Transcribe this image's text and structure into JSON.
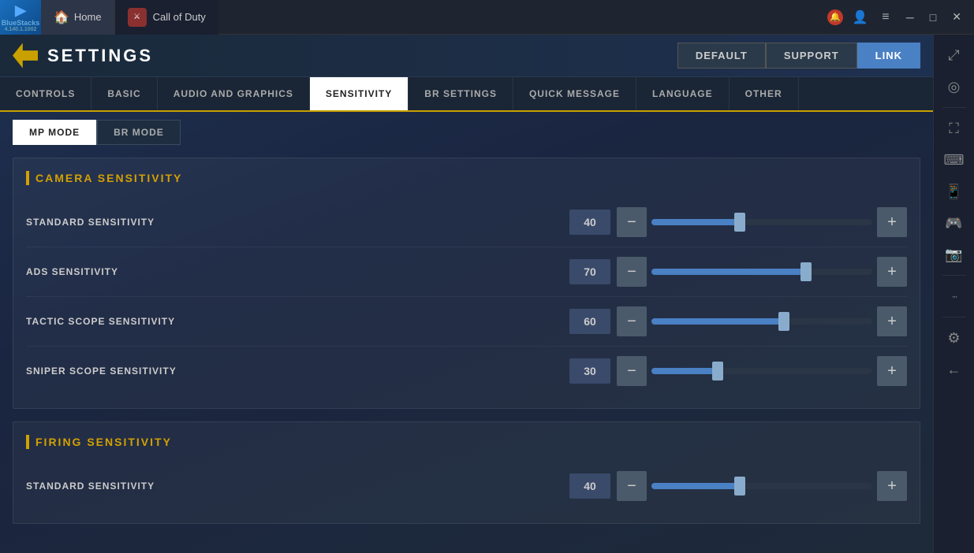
{
  "taskbar": {
    "app_name": "BlueStacks",
    "app_version": "4.140.1.1002",
    "tab_home": "Home",
    "tab_game": "Call of Duty",
    "window_controls": {
      "minimize": "─",
      "maximize": "□",
      "close": "✕"
    }
  },
  "settings": {
    "title": "SETTINGS",
    "header_buttons": [
      {
        "label": "DEFAULT",
        "active": false
      },
      {
        "label": "SUPPORT",
        "active": false
      },
      {
        "label": "LINK",
        "active": true
      }
    ],
    "nav_tabs": [
      {
        "label": "CONTROLS",
        "active": false
      },
      {
        "label": "BASIC",
        "active": false
      },
      {
        "label": "AUDIO AND GRAPHICS",
        "active": false
      },
      {
        "label": "SENSITIVITY",
        "active": true
      },
      {
        "label": "BR SETTINGS",
        "active": false
      },
      {
        "label": "QUICK MESSAGE",
        "active": false
      },
      {
        "label": "LANGUAGE",
        "active": false
      },
      {
        "label": "OTHER",
        "active": false
      }
    ],
    "mode_tabs": [
      {
        "label": "MP MODE",
        "active": true
      },
      {
        "label": "BR MODE",
        "active": false
      }
    ],
    "camera_section": {
      "title": "CAMERA SENSITIVITY",
      "rows": [
        {
          "label": "STANDARD SENSITIVITY",
          "value": "40",
          "pct": 40
        },
        {
          "label": "ADS SENSITIVITY",
          "value": "70",
          "pct": 70
        },
        {
          "label": "TACTIC SCOPE SENSITIVITY",
          "value": "60",
          "pct": 60
        },
        {
          "label": "SNIPER SCOPE SENSITIVITY",
          "value": "30",
          "pct": 30
        }
      ]
    },
    "firing_section": {
      "title": "FIRING SENSITIVITY",
      "rows": [
        {
          "label": "STANDARD SENSITIVITY",
          "value": "40",
          "pct": 40
        }
      ]
    }
  },
  "right_sidebar": {
    "icons": [
      {
        "name": "expand-icon",
        "glyph": "⤢"
      },
      {
        "name": "search-icon",
        "glyph": "◎"
      },
      {
        "name": "fullscreen-icon",
        "glyph": "⛶"
      },
      {
        "name": "keyboard-icon",
        "glyph": "⌨"
      },
      {
        "name": "phone-icon",
        "glyph": "📱"
      },
      {
        "name": "gamepad-icon",
        "glyph": "🎮"
      },
      {
        "name": "camera2-icon",
        "glyph": "📷"
      },
      {
        "name": "more-icon",
        "glyph": "···"
      },
      {
        "name": "gear-icon",
        "glyph": "⚙"
      },
      {
        "name": "back-icon",
        "glyph": "←"
      }
    ]
  }
}
